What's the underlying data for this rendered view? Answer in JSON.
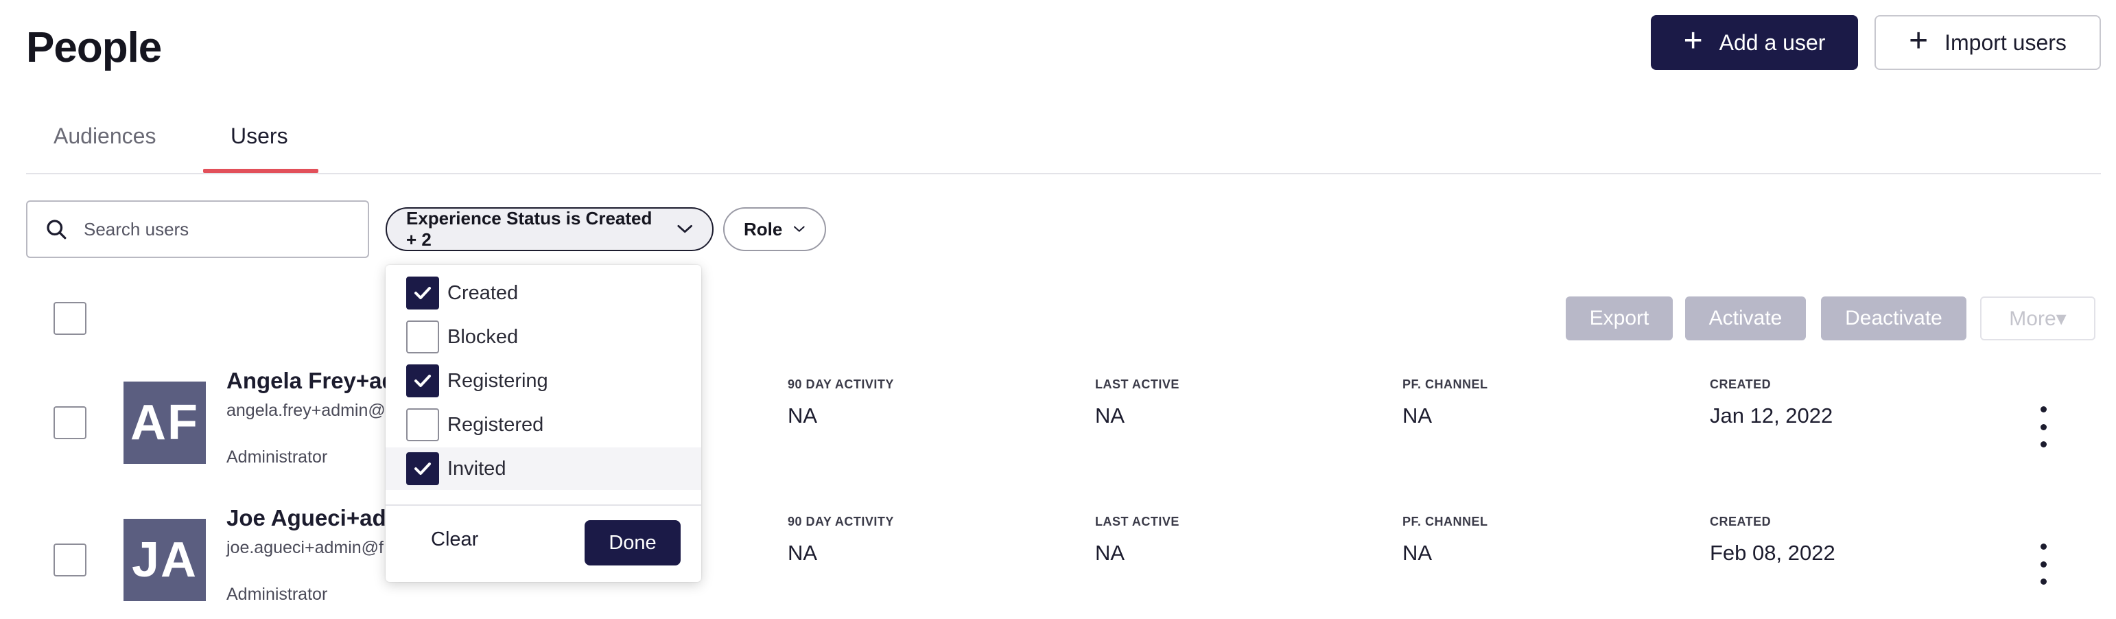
{
  "page": {
    "title": "People"
  },
  "header": {
    "add_user_label": "Add a user",
    "import_users_label": "Import users"
  },
  "tabs": [
    {
      "label": "Audiences"
    },
    {
      "label": "Users"
    }
  ],
  "search": {
    "placeholder": "Search users"
  },
  "filters": {
    "status_label": "Experience Status is Created + 2",
    "role_label": "Role"
  },
  "status_dropdown": {
    "options": [
      {
        "label": "Created",
        "checked": true
      },
      {
        "label": "Blocked",
        "checked": false
      },
      {
        "label": "Registering",
        "checked": true
      },
      {
        "label": "Registered",
        "checked": false
      },
      {
        "label": "Invited",
        "checked": true
      }
    ],
    "clear_label": "Clear",
    "done_label": "Done"
  },
  "actions": {
    "export": "Export",
    "activate": "Activate",
    "deactivate": "Deactivate",
    "more": "More▾"
  },
  "columns": {
    "activity": "90 DAY ACTIVITY",
    "last_active": "LAST ACTIVE",
    "channel": "PF. CHANNEL",
    "created": "CREATED"
  },
  "users": [
    {
      "initials": "AF",
      "name": "Angela Frey+ad",
      "email": "angela.frey+admin@",
      "role": "Administrator",
      "activity": "NA",
      "last_active": "NA",
      "channel": "NA",
      "created": "Jan 12, 2022"
    },
    {
      "initials": "JA",
      "name": "Joe Agueci+ad",
      "email": "joe.agueci+admin@f",
      "role": "Administrator",
      "activity": "NA",
      "last_active": "NA",
      "channel": "NA",
      "created": "Feb 08, 2022"
    }
  ],
  "colors": {
    "primary": "#1b1a47",
    "tab_accent": "#e2505a",
    "avatar_bg": "#5b5e80",
    "disabled_button": "#b8b8c8"
  }
}
